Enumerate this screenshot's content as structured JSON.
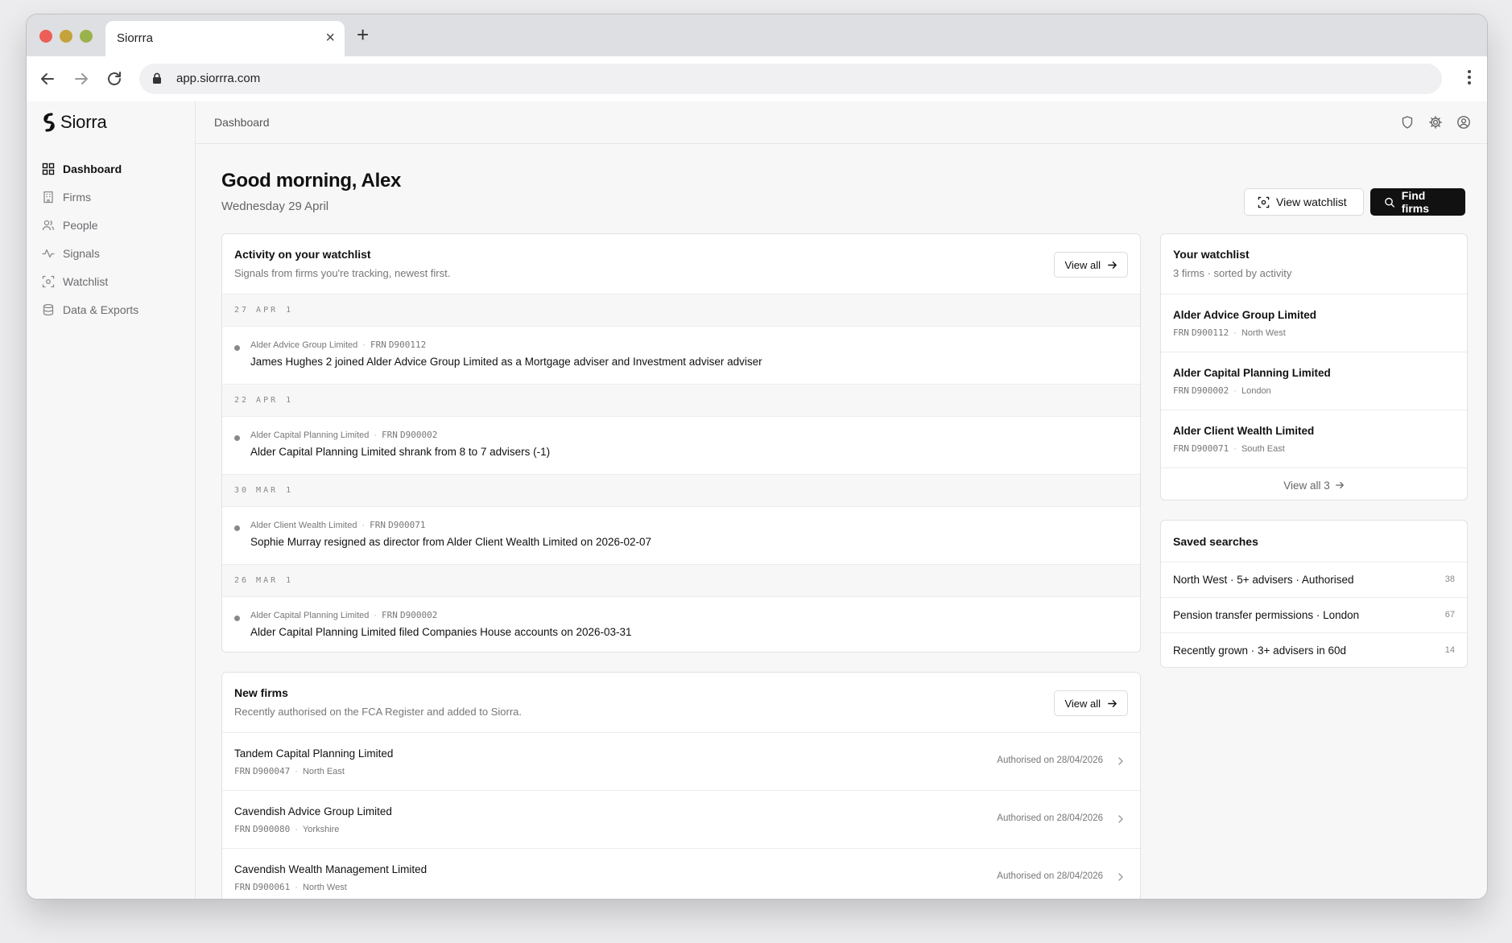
{
  "browser": {
    "tab_title": "Siorrra",
    "url": "app.siorrra.com"
  },
  "brand": {
    "name": "Siorra"
  },
  "sidebar": {
    "items": [
      {
        "label": "Dashboard",
        "icon": "grid-icon",
        "active": true
      },
      {
        "label": "Firms",
        "icon": "building-icon",
        "active": false
      },
      {
        "label": "People",
        "icon": "people-icon",
        "active": false
      },
      {
        "label": "Signals",
        "icon": "activity-icon",
        "active": false
      },
      {
        "label": "Watchlist",
        "icon": "watch-icon",
        "active": false
      },
      {
        "label": "Data & Exports",
        "icon": "database-icon",
        "active": false
      }
    ]
  },
  "topbar": {
    "breadcrumb": "Dashboard"
  },
  "header": {
    "greeting": "Good morning, Alex",
    "date": "Wednesday 29 April",
    "view_watchlist_label": "View watchlist",
    "find_firms_label": "Find firms"
  },
  "activity": {
    "title": "Activity on your watchlist",
    "subtitle": "Signals from firms you're tracking, newest first.",
    "view_all_label": "View all",
    "groups": [
      {
        "day": "27 APR",
        "count": "1",
        "items": [
          {
            "firm": "Alder Advice Group Limited",
            "frn_label": "FRN",
            "frn": "D900112",
            "text": "James Hughes 2 joined Alder Advice Group Limited as a Mortgage adviser and Investment adviser adviser"
          }
        ]
      },
      {
        "day": "22 APR",
        "count": "1",
        "items": [
          {
            "firm": "Alder Capital Planning Limited",
            "frn_label": "FRN",
            "frn": "D900002",
            "text": "Alder Capital Planning Limited shrank from 8 to 7 advisers (-1)"
          }
        ]
      },
      {
        "day": "30 MAR",
        "count": "1",
        "items": [
          {
            "firm": "Alder Client Wealth Limited",
            "frn_label": "FRN",
            "frn": "D900071",
            "text": "Sophie Murray resigned as director from Alder Client Wealth Limited on 2026-02-07"
          }
        ]
      },
      {
        "day": "26 MAR",
        "count": "1",
        "items": [
          {
            "firm": "Alder Capital Planning Limited",
            "frn_label": "FRN",
            "frn": "D900002",
            "text": "Alder Capital Planning Limited filed Companies House accounts on 2026-03-31"
          }
        ]
      }
    ]
  },
  "new_firms": {
    "title": "New firms",
    "subtitle": "Recently authorised on the FCA Register and added to Siorra.",
    "view_all_label": "View all",
    "rows": [
      {
        "name": "Tandem Capital Planning Limited",
        "frn_label": "FRN",
        "frn": "D900047",
        "region": "North East",
        "authorised": "Authorised on 28/04/2026"
      },
      {
        "name": "Cavendish Advice Group Limited",
        "frn_label": "FRN",
        "frn": "D900080",
        "region": "Yorkshire",
        "authorised": "Authorised on 28/04/2026"
      },
      {
        "name": "Cavendish Wealth Management Limited",
        "frn_label": "FRN",
        "frn": "D900061",
        "region": "North West",
        "authorised": "Authorised on 28/04/2026"
      }
    ]
  },
  "watchlist": {
    "title": "Your watchlist",
    "subtitle": "3 firms · sorted by activity",
    "footer_label": "View all 3",
    "rows": [
      {
        "name": "Alder Advice Group Limited",
        "frn_label": "FRN",
        "frn": "D900112",
        "region": "North West"
      },
      {
        "name": "Alder Capital Planning Limited",
        "frn_label": "FRN",
        "frn": "D900002",
        "region": "London"
      },
      {
        "name": "Alder Client Wealth Limited",
        "frn_label": "FRN",
        "frn": "D900071",
        "region": "South East"
      }
    ]
  },
  "saved_searches": {
    "title": "Saved searches",
    "rows": [
      {
        "label": "North West · 5+ advisers · Authorised",
        "count": "38"
      },
      {
        "label": "Pension transfer permissions · London",
        "count": "67"
      },
      {
        "label": "Recently grown · 3+ advisers in 60d",
        "count": "14"
      }
    ]
  },
  "colors": {
    "primary_button": "#111111",
    "traffic_red": "#ec5f57",
    "traffic_yellow": "#c4a43a",
    "traffic_green": "#9ab24b"
  }
}
